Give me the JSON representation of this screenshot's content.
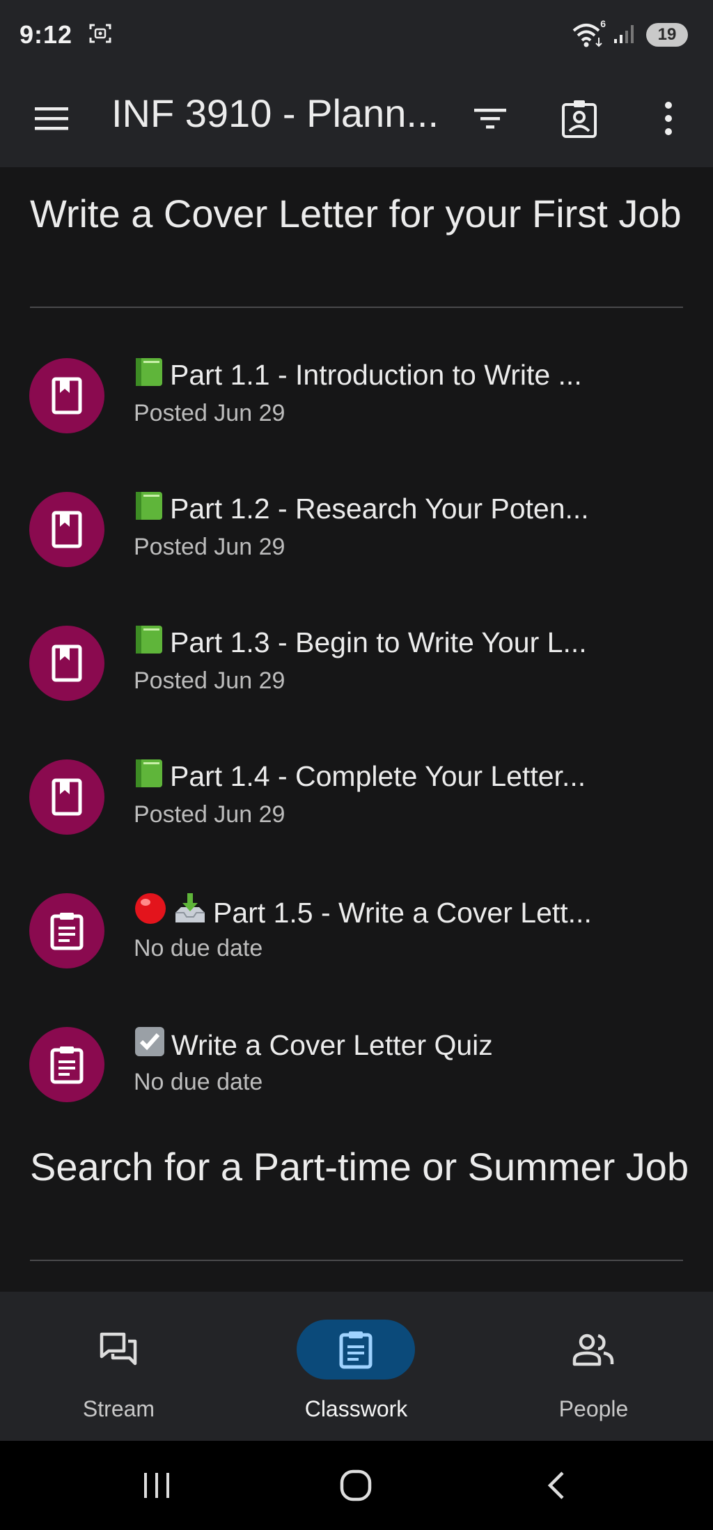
{
  "status_bar": {
    "time": "9:12",
    "battery": "19",
    "wifi_badge": "6"
  },
  "app_bar": {
    "title": "INF 3910 - Plann...",
    "icons": [
      "menu-icon",
      "filter-icon",
      "classroom-badge-icon",
      "more-vert-icon"
    ]
  },
  "sections": [
    {
      "title": "Write a Cover Letter for your First Job",
      "items": [
        {
          "icon": "material-icon",
          "emoji": "green-book",
          "title": "Part 1.1 - Introduction to Write ...",
          "subtitle": "Posted Jun 29"
        },
        {
          "icon": "material-icon",
          "emoji": "green-book",
          "title": "Part 1.2 - Research Your Poten...",
          "subtitle": "Posted Jun 29"
        },
        {
          "icon": "material-icon",
          "emoji": "green-book",
          "title": "Part 1.3 - Begin to Write Your L...",
          "subtitle": "Posted Jun 29"
        },
        {
          "icon": "material-icon",
          "emoji": "green-book",
          "title": "Part 1.4 - Complete Your Letter...",
          "subtitle": "Posted Jun 29"
        },
        {
          "icon": "assignment-icon",
          "emoji": "red-circle inbox-tray",
          "title": "Part 1.5 - Write a Cover Lett...",
          "subtitle": "No due date"
        },
        {
          "icon": "assignment-icon",
          "emoji": "check-box",
          "title": "Write a Cover Letter Quiz",
          "subtitle": "No due date"
        }
      ]
    },
    {
      "title": "Search for a Part-time or Summer Job",
      "items": []
    }
  ],
  "bottom_nav": {
    "items": [
      {
        "label": "Stream",
        "icon": "stream-icon",
        "active": false
      },
      {
        "label": "Classwork",
        "icon": "classwork-icon",
        "active": true
      },
      {
        "label": "People",
        "icon": "people-icon",
        "active": false
      }
    ]
  },
  "colors": {
    "background": "#161617",
    "app_bar": "#232427",
    "avatar": "#8a0a4f",
    "active_pill": "#0b4a7a"
  }
}
